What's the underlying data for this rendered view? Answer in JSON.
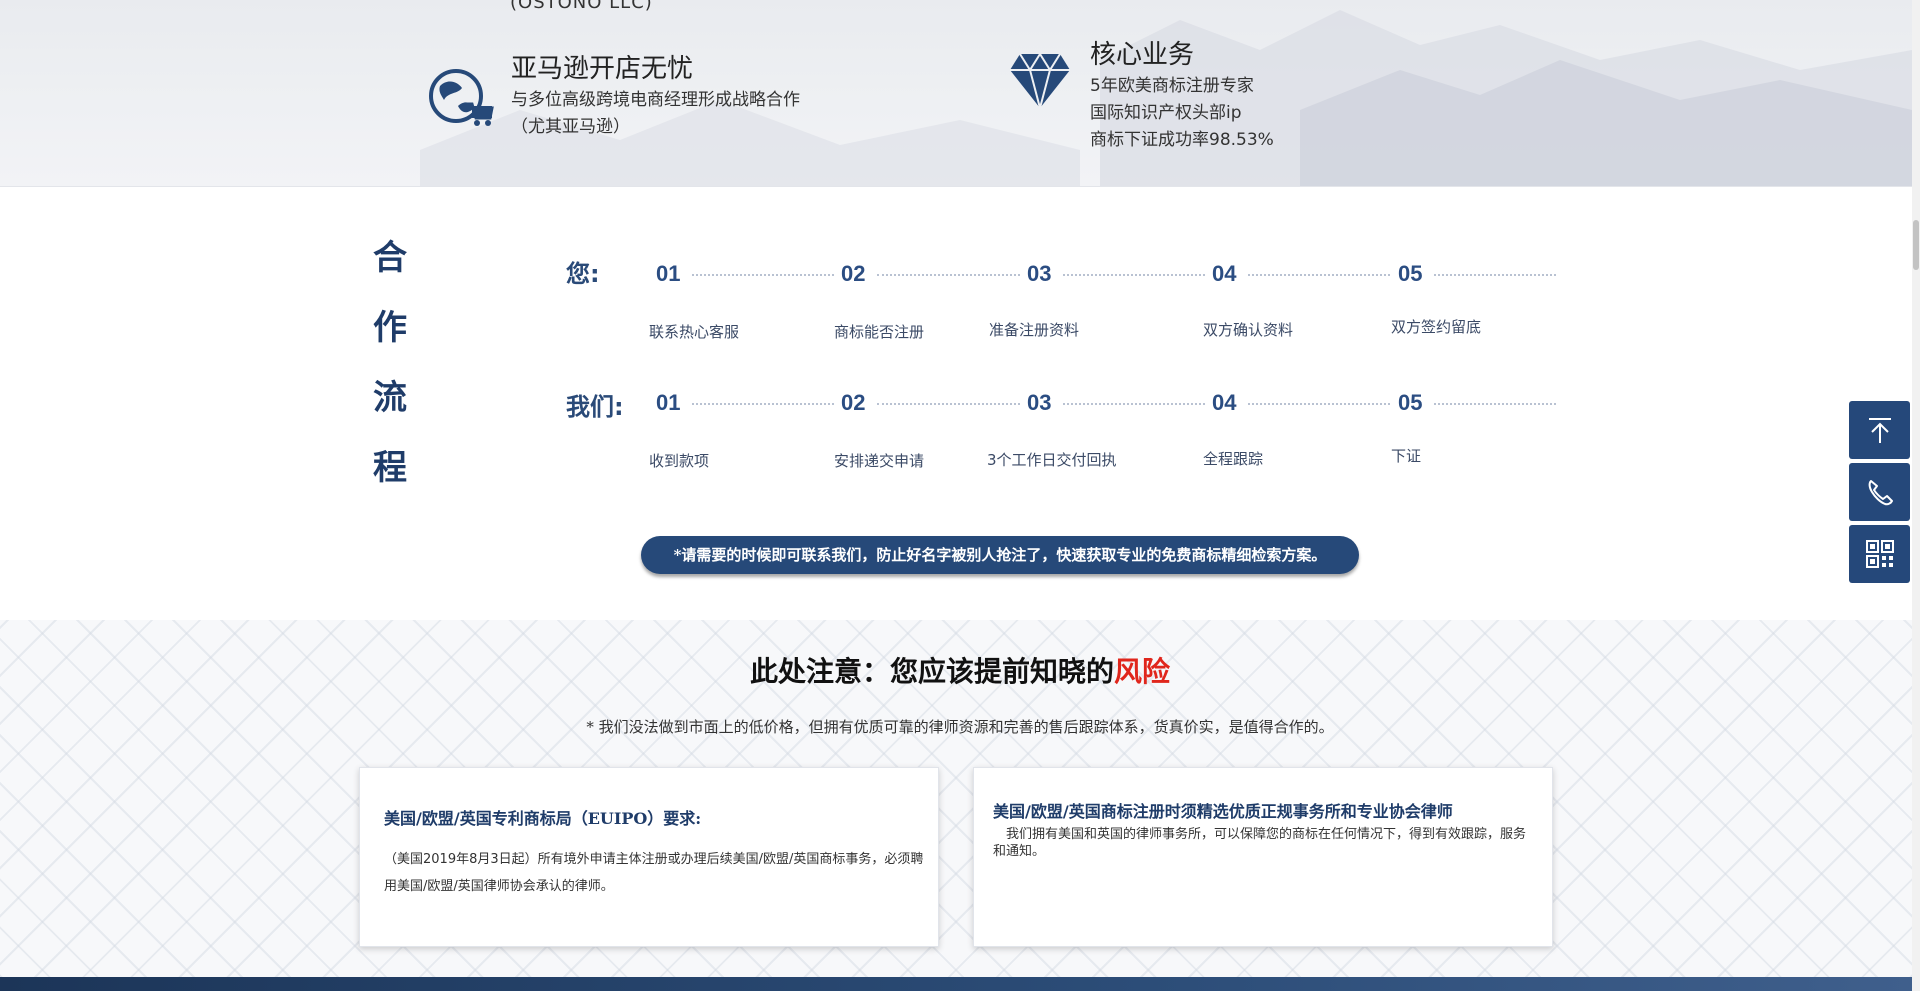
{
  "banner": {
    "cut_text": "(OSTONO LLC)",
    "feature_left": {
      "title": "亚马逊开店无忧",
      "lines": [
        "与多位高级跨境电商经理形成战略合作",
        "（尤其亚马逊）"
      ]
    },
    "feature_right": {
      "title": "核心业务",
      "lines": [
        "5年欧美商标注册专家",
        "国际知识产权头部ip",
        "商标下证成功率98.53%"
      ]
    },
    "icons": {
      "left": "globe-cart-icon",
      "right": "diamond-icon"
    }
  },
  "process": {
    "side_title": [
      "合",
      "作",
      "流",
      "程"
    ],
    "row_you": {
      "label": "您:",
      "steps": [
        {
          "num": "01",
          "label": "联系热心客服"
        },
        {
          "num": "02",
          "label": "商标能否注册"
        },
        {
          "num": "03",
          "label": "准备注册资料"
        },
        {
          "num": "04",
          "label": "双方确认资料"
        },
        {
          "num": "05",
          "label": "双方签约留底"
        }
      ]
    },
    "row_us": {
      "label": "我们:",
      "steps": [
        {
          "num": "01",
          "label": "收到款项"
        },
        {
          "num": "02",
          "label": "安排递交申请"
        },
        {
          "num": "03",
          "label": "3个工作日交付回执"
        },
        {
          "num": "04",
          "label": "全程跟踪"
        },
        {
          "num": "05",
          "label": "下证"
        }
      ]
    },
    "notice": "*请需要的时候即可联系我们，防止好名字被别人抢注了，快速获取专业的免费商标精细检索方案。"
  },
  "risk": {
    "title_main": "此处注意：您应该提前知晓的",
    "title_highlight": "风险",
    "subtitle": "* 我们没法做到市面上的低价格，但拥有优质可靠的律师资源和完善的售后跟踪体系，货真价实，是值得合作的。",
    "card_left": {
      "title": "美国/欧盟/英国专利商标局（EUIPO）要求:",
      "body": "（美国2019年8月3日起）所有境外申请主体注册或办理后续美国/欧盟/英国商标事务，必须聘用美国/欧盟/英国律师协会承认的律师。"
    },
    "card_right": {
      "title": "美国/欧盟/英国商标注册时须精选优质正规事务所和专业协会律师",
      "body": "　我们拥有美国和英国的律师事务所，可以保障您的商标在任何情况下，得到有效跟踪，服务和通知。"
    }
  },
  "floating": {
    "buttons": [
      "back-to-top-icon",
      "phone-icon",
      "qr-code-icon"
    ]
  },
  "colors": {
    "navy": "#25487a",
    "accent_red": "#e0261c"
  }
}
